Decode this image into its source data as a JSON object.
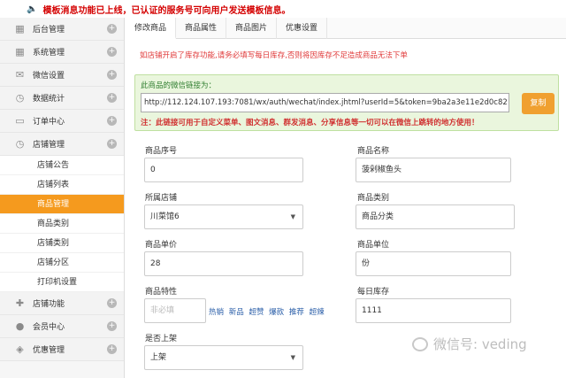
{
  "notice": {
    "icon": "speaker-icon",
    "text": "模板消息功能已上线，已认证的服务号可向用户发送模板信息。"
  },
  "sidebar": {
    "items": [
      {
        "label": "后台管理",
        "icon": "grid-icon"
      },
      {
        "label": "系统管理",
        "icon": "grid-icon"
      },
      {
        "label": "微信设置",
        "icon": "mail-icon"
      },
      {
        "label": "数据统计",
        "icon": "clock-icon"
      },
      {
        "label": "订单中心",
        "icon": "folder-icon"
      },
      {
        "label": "店铺管理",
        "icon": "clock-icon"
      }
    ],
    "submenu": [
      {
        "label": "店铺公告"
      },
      {
        "label": "店铺列表"
      },
      {
        "label": "商品管理",
        "active": true
      },
      {
        "label": "商品类别"
      },
      {
        "label": "店铺类别"
      },
      {
        "label": "店铺分区"
      },
      {
        "label": "打印机设置"
      }
    ],
    "bottom_items": [
      {
        "label": "店铺功能",
        "icon": "plus-icon"
      },
      {
        "label": "会员中心",
        "icon": "user-icon"
      },
      {
        "label": "优惠管理",
        "icon": "tag-icon"
      }
    ]
  },
  "tabs": [
    {
      "label": "修改商品",
      "active": true
    },
    {
      "label": "商品属性"
    },
    {
      "label": "商品图片"
    },
    {
      "label": "优惠设置"
    }
  ],
  "warning": "如店铺开启了库存功能,请务必填写每日库存,否则将因库存不足造成商品无法下单",
  "link_box": {
    "title": "此商品的微信链接为：",
    "url": "http://112.124.107.193:7081/wx/auth/wechat/index.jhtml?userId=5&token=9ba2a3e11e2d0c82",
    "copy_label": "复制",
    "note": "注：此链接可用于自定义菜单、图文消息、群发消息、分享信息等一切可以在微信上跳转的地方使用！"
  },
  "form": {
    "seq_label": "商品序号",
    "seq_value": "0",
    "name_label": "商品名称",
    "name_value": "菠剁椒鱼头",
    "store_label": "所属店铺",
    "store_value": "川菜馆6",
    "category_label": "商品类别",
    "category_value": "商品分类",
    "price_label": "商品单价",
    "price_value": "28",
    "unit_label": "商品单位",
    "unit_value": "份",
    "feature_label": "商品特性",
    "feature_placeholder": "非必填",
    "feature_tags": [
      "热销",
      "新品",
      "超赞",
      "爆款",
      "推荐",
      "超辣"
    ],
    "stock_label": "每日库存",
    "stock_value": "1111",
    "onsale_label": "是否上架",
    "onsale_value": "上架"
  },
  "watermark": "微信号: veding"
}
